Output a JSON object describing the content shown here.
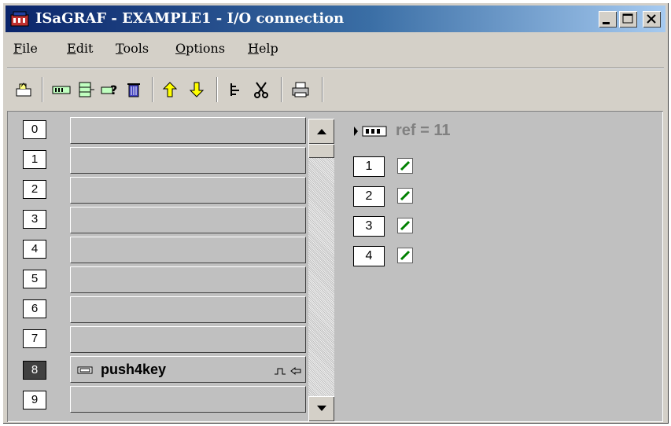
{
  "window": {
    "title": "ISaGRAF - EXAMPLE1 - I/O connection",
    "controls": [
      "minimize",
      "maximize",
      "close"
    ]
  },
  "menu": {
    "items": [
      {
        "label": "File",
        "underline": "F",
        "rest": "ile"
      },
      {
        "label": "Edit",
        "underline": "E",
        "rest": "dit"
      },
      {
        "label": "Tools",
        "underline": "T",
        "rest": "ools"
      },
      {
        "label": "Options",
        "underline": "O",
        "rest": "ptions"
      },
      {
        "label": "Help",
        "underline": "H",
        "rest": "elp"
      }
    ]
  },
  "toolbar": {
    "icons": [
      "open-icon",
      "board-icon",
      "stack-board-icon",
      "help-board-icon",
      "trash-icon",
      "arrow-up-icon",
      "arrow-down-icon",
      "tree-icon",
      "cut-icon",
      "print-icon"
    ]
  },
  "channels": [
    {
      "num": "0",
      "label": "",
      "selected": false
    },
    {
      "num": "1",
      "label": "",
      "selected": false
    },
    {
      "num": "2",
      "label": "",
      "selected": false
    },
    {
      "num": "3",
      "label": "",
      "selected": false
    },
    {
      "num": "4",
      "label": "",
      "selected": false
    },
    {
      "num": "5",
      "label": "",
      "selected": false
    },
    {
      "num": "6",
      "label": "",
      "selected": false
    },
    {
      "num": "7",
      "label": "",
      "selected": false
    },
    {
      "num": "8",
      "label": "push4key",
      "selected": true
    },
    {
      "num": "9",
      "label": "",
      "selected": false
    }
  ],
  "details": {
    "ref": "ref = 11",
    "bits": [
      "1",
      "2",
      "3",
      "4"
    ]
  },
  "colors": {
    "title_start": "#0a246a",
    "title_end": "#a6caf0",
    "face": "#d4d0c8",
    "content_bg": "#c0c0c0",
    "arrow_yellow": "#ffff00",
    "check_green": "#008000"
  }
}
